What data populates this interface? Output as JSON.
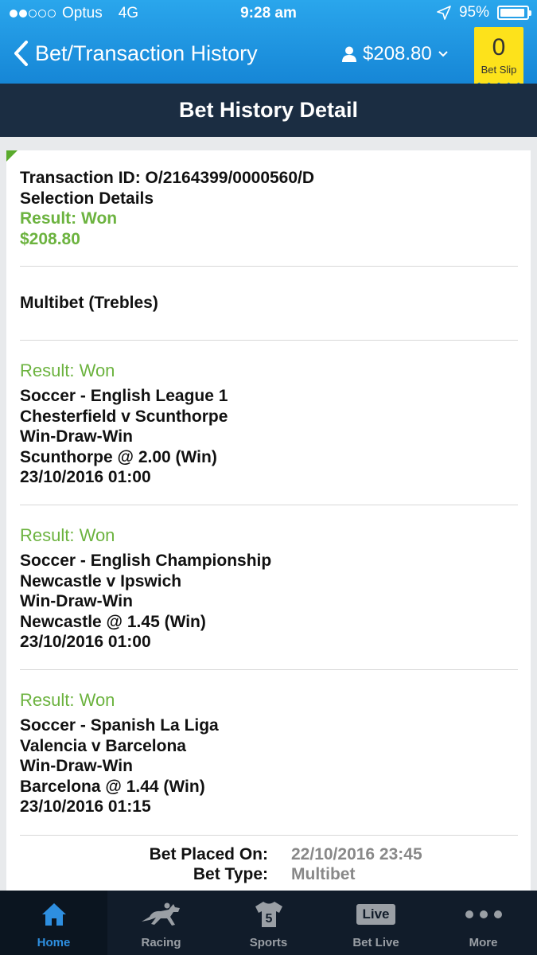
{
  "status_bar": {
    "carrier": "Optus",
    "network": "4G",
    "time": "9:28 am",
    "battery": "95%",
    "battery_level": 0.95
  },
  "header": {
    "back_title": "Bet/Transaction History",
    "balance": "$208.80",
    "bet_slip_count": "0",
    "bet_slip_label": "Bet Slip"
  },
  "subheader": {
    "title": "Bet History Detail"
  },
  "transaction": {
    "id_line": "Transaction ID: O/2164399/0000560/D",
    "selection_details": "Selection Details",
    "result": "Result: Won",
    "amount": "$208.80"
  },
  "bet_kind": "Multibet (Trebles)",
  "legs": [
    {
      "result": "Result: Won",
      "competition": "Soccer - English League 1",
      "match": "Chesterfield v Scunthorpe",
      "market": "Win-Draw-Win",
      "selection": "Scunthorpe @ 2.00 (Win)",
      "datetime": "23/10/2016 01:00"
    },
    {
      "result": "Result: Won",
      "competition": "Soccer - English Championship",
      "match": "Newcastle v Ipswich",
      "market": "Win-Draw-Win",
      "selection": "Newcastle @ 1.45 (Win)",
      "datetime": "23/10/2016 01:00"
    },
    {
      "result": "Result: Won",
      "competition": "Soccer - Spanish La Liga",
      "match": "Valencia v Barcelona",
      "market": "Win-Draw-Win",
      "selection": "Barcelona @ 1.44 (Win)",
      "datetime": "23/10/2016 01:15"
    }
  ],
  "details": [
    {
      "label": "Bet Placed On:",
      "value": "22/10/2016 23:45"
    },
    {
      "label": "Bet Type:",
      "value": "Multibet"
    }
  ],
  "tabs": [
    {
      "label": "Home",
      "icon": "home-icon",
      "active": true
    },
    {
      "label": "Racing",
      "icon": "horse-racing-icon",
      "active": false
    },
    {
      "label": "Sports",
      "icon": "jersey-icon",
      "active": false,
      "icon_text": "5"
    },
    {
      "label": "Bet Live",
      "icon": "live-icon",
      "active": false,
      "icon_text": "Live"
    },
    {
      "label": "More",
      "icon": "more-dots-icon",
      "active": false
    }
  ],
  "colors": {
    "header_blue": "#1d8fdf",
    "navy": "#1b2d42",
    "won_green": "#6cb33f",
    "bet_slip_yellow": "#fde21b",
    "active_tab": "#2e8fe0"
  }
}
